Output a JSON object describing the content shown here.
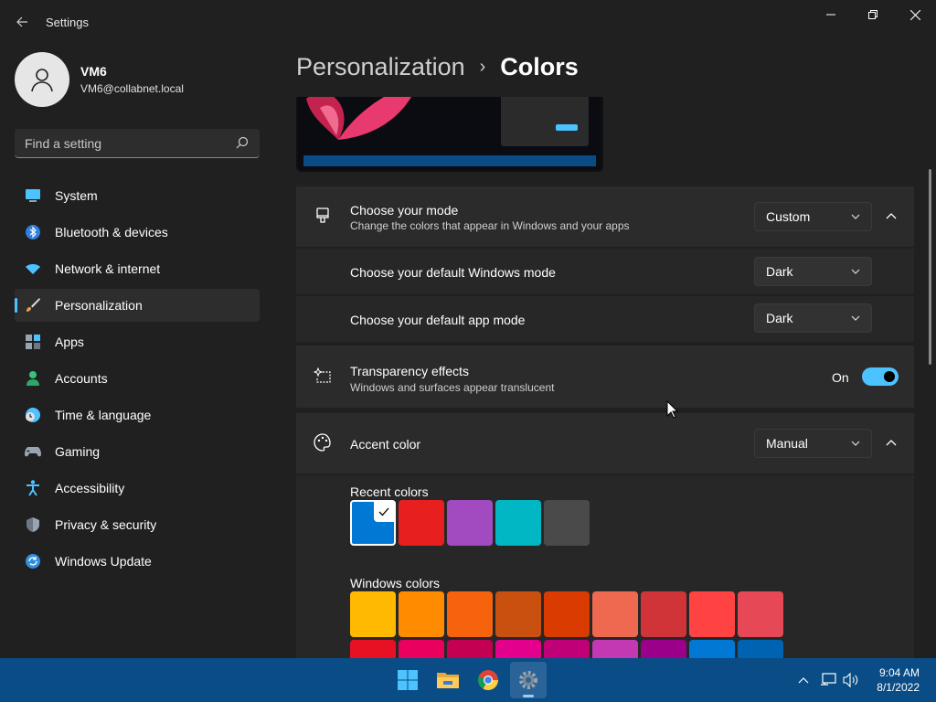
{
  "window": {
    "title": "Settings",
    "controls": [
      "minimize-icon",
      "restore-icon",
      "close-icon"
    ]
  },
  "profile": {
    "name": "VM6",
    "email": "VM6@collabnet.local"
  },
  "search": {
    "placeholder": "Find a setting"
  },
  "sidebar": {
    "items": [
      {
        "label": "System",
        "icon": "monitor-icon",
        "color": "#4cc2ff"
      },
      {
        "label": "Bluetooth & devices",
        "icon": "bluetooth-icon",
        "color": "#3b8fe8"
      },
      {
        "label": "Network & internet",
        "icon": "wifi-icon",
        "color": "#4cc2ff"
      },
      {
        "label": "Personalization",
        "icon": "brush-icon",
        "color": "#e8a04c"
      },
      {
        "label": "Apps",
        "icon": "apps-icon",
        "color": "#9aa4b0"
      },
      {
        "label": "Accounts",
        "icon": "person-icon",
        "color": "#36c47b"
      },
      {
        "label": "Time & language",
        "icon": "clock-globe-icon",
        "color": "#4cc2ff"
      },
      {
        "label": "Gaming",
        "icon": "gamepad-icon",
        "color": "#9aa4b0"
      },
      {
        "label": "Accessibility",
        "icon": "accessibility-icon",
        "color": "#4cc2ff"
      },
      {
        "label": "Privacy & security",
        "icon": "shield-icon",
        "color": "#9aa4b0"
      },
      {
        "label": "Windows Update",
        "icon": "update-icon",
        "color": "#4cc2ff"
      }
    ],
    "selected_index": 3
  },
  "breadcrumb": {
    "parent": "Personalization",
    "separator": "›",
    "current": "Colors"
  },
  "mode": {
    "title": "Choose your mode",
    "description": "Change the colors that appear in Windows and your apps",
    "value": "Custom",
    "expanded": true,
    "windows_mode_label": "Choose your default Windows mode",
    "windows_mode_value": "Dark",
    "app_mode_label": "Choose your default app mode",
    "app_mode_value": "Dark"
  },
  "transparency": {
    "title": "Transparency effects",
    "description": "Windows and surfaces appear translucent",
    "state_label": "On",
    "enabled": true
  },
  "accent": {
    "title": "Accent color",
    "value": "Manual",
    "expanded": true,
    "recent_label": "Recent colors",
    "recent_colors": [
      "#0078d4",
      "#e81f1f",
      "#a24bc1",
      "#00b7c3",
      "#4a4a4a"
    ],
    "recent_selected_index": 0,
    "windows_label": "Windows colors",
    "windows_colors_row1": [
      "#ffb900",
      "#ff8c00",
      "#f7630c",
      "#ca5010",
      "#da3b01",
      "#ef6950",
      "#d13438",
      "#ff4343",
      "#e74856"
    ],
    "windows_colors_row2": [
      "#e81123",
      "#ea005e",
      "#c30052",
      "#e3008c",
      "#bf0077",
      "#c239b3",
      "#9a0089",
      "#0078d4",
      "#0063b1"
    ]
  },
  "taskbar": {
    "apps": [
      "windows-start-icon",
      "file-explorer-icon",
      "chrome-icon",
      "settings-gear-icon"
    ],
    "active_index": 3,
    "time": "9:04 AM",
    "date": "8/1/2022"
  },
  "colors": {
    "accent": "#4cc2ff",
    "background": "#202020",
    "card": "#2b2b2b",
    "taskbar": "#0a4c85"
  }
}
